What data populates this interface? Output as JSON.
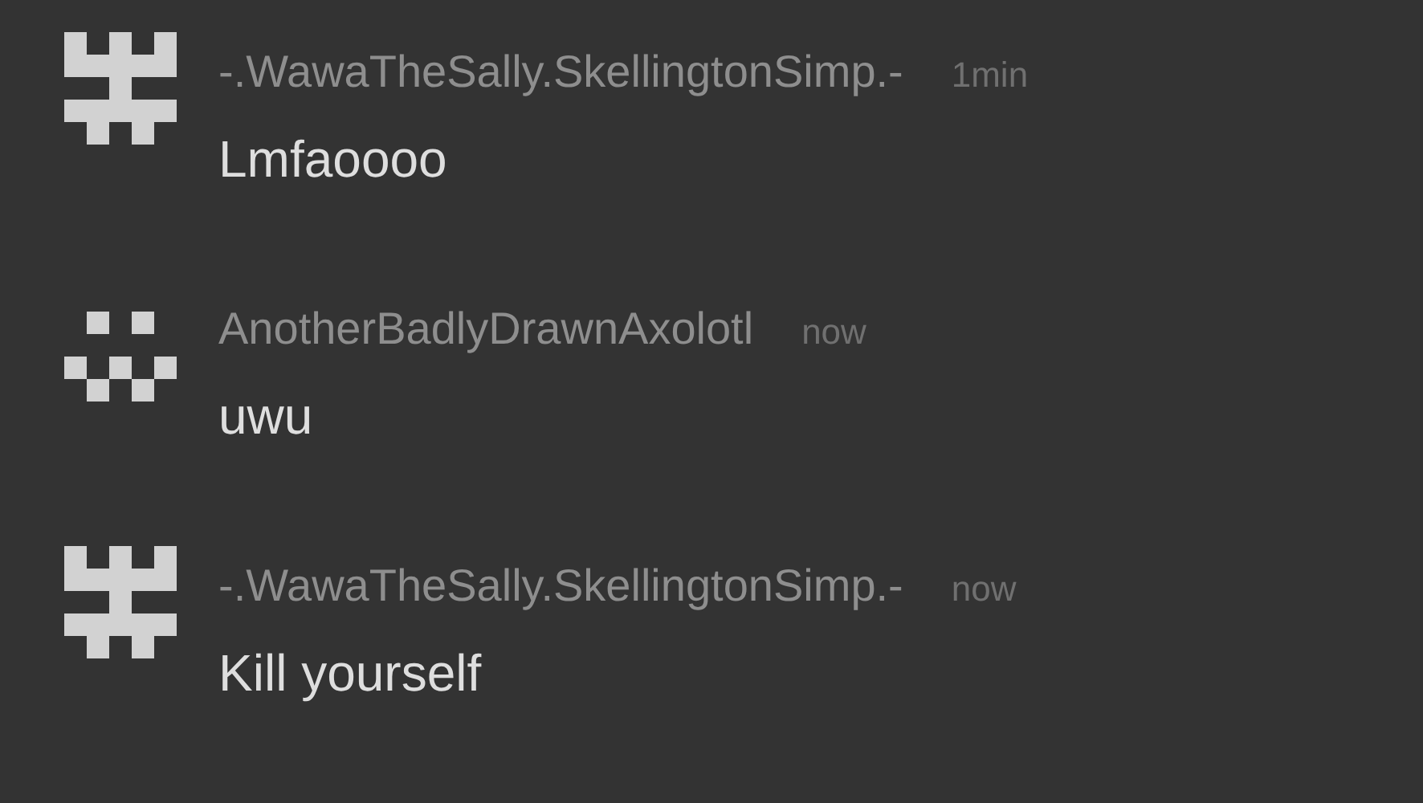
{
  "messages": [
    {
      "kind": "tower",
      "author": "-.WawaTheSally.SkellingtonSimp.-",
      "time": "1min",
      "text": "Lmfaoooo"
    },
    {
      "kind": "dots",
      "author": "AnotherBadlyDrawnAxolotl",
      "time": "now",
      "text": "uwu"
    },
    {
      "kind": "tower",
      "author": "-.WawaTheSally.SkellingtonSimp.-",
      "time": "now",
      "text": "Kill yourself"
    }
  ]
}
